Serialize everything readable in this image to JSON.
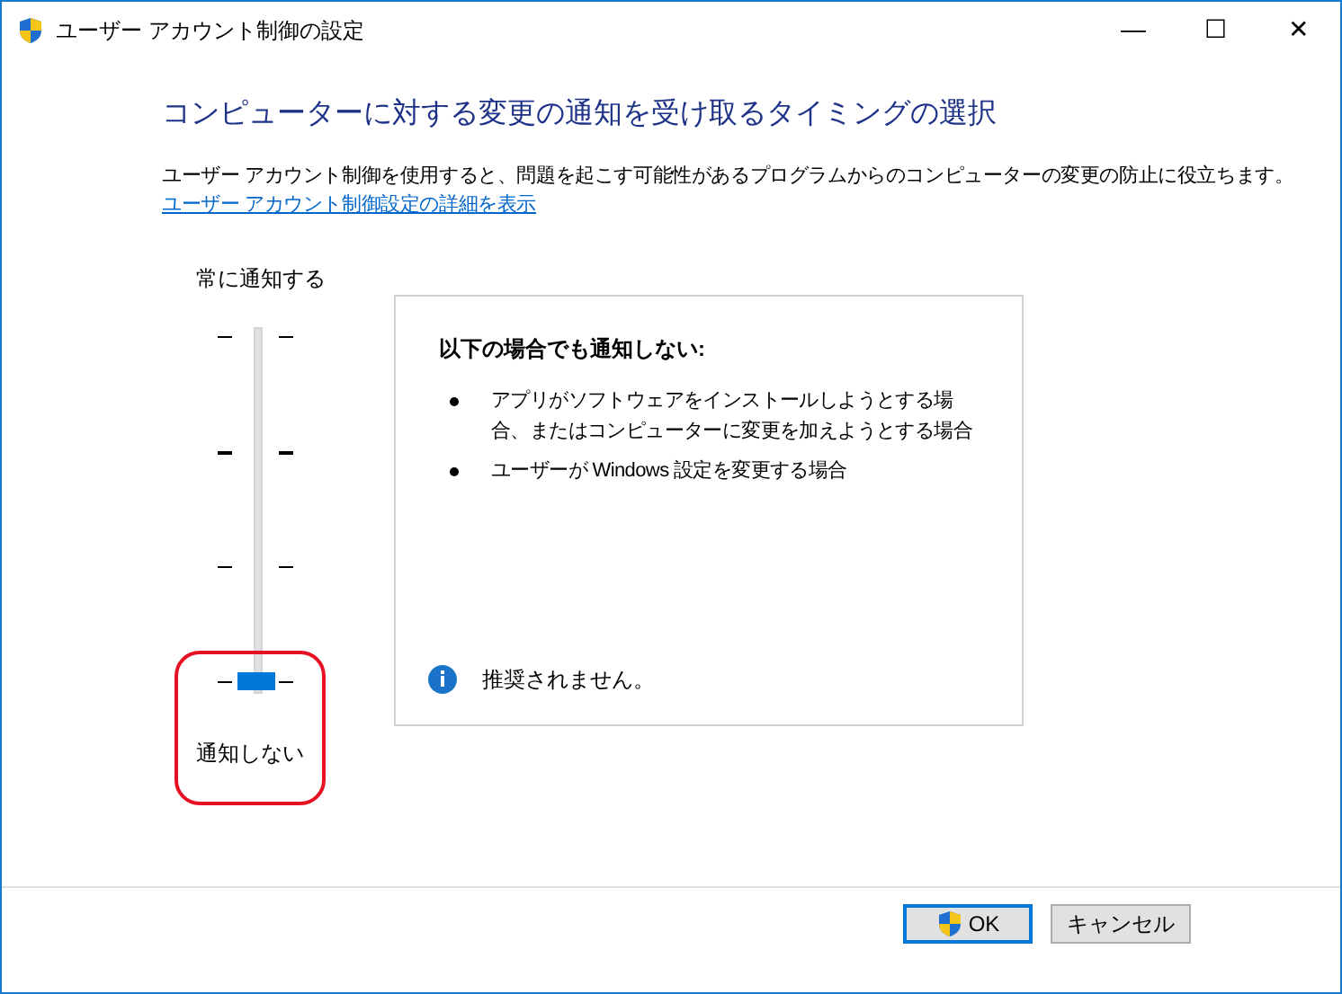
{
  "window": {
    "title": "ユーザー アカウント制御の設定",
    "controls": [
      "—",
      "☐",
      "✕"
    ]
  },
  "heading": "コンピューターに対する変更の通知を受け取るタイミングの選択",
  "description": "ユーザー アカウント制御を使用すると、問題を起こす可能性があるプログラムからのコンピューターの変更の防止に役立ちます。",
  "details_link": "ユーザー アカウント制御設定の詳細を表示",
  "slider": {
    "top_label": "常に通知する",
    "bottom_label": "通知しない",
    "level": 0,
    "highlighted": true
  },
  "info_panel": {
    "title": "以下の場合でも通知しない:",
    "bullets": [
      "アプリがソフトウェアをインストールしようとする場合、またはコンピューターに変更を加えようとする場合",
      "ユーザーが Windows 設定を変更する場合"
    ],
    "note": "推奨されません。"
  },
  "buttons": [
    {
      "label": "OK",
      "shield": true,
      "default": true
    },
    {
      "label": "キャンセル",
      "shield": false,
      "default": false
    }
  ]
}
